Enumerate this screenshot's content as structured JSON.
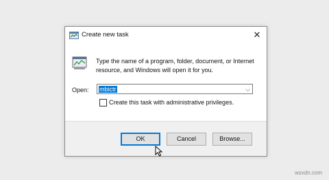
{
  "window": {
    "title": "Create new task",
    "close_glyph": "✕"
  },
  "dialog": {
    "description": "Type the name of a program, folder, document, or Internet resource, and Windows will open it for you.",
    "open_label": "Open:",
    "open_value": "mbictr",
    "dropdown_glyph": "⌵",
    "admin_checkbox_label": "Create this task with administrative privileges.",
    "admin_checkbox_checked": false
  },
  "buttons": {
    "ok": "OK",
    "cancel": "Cancel",
    "browse": "Browse..."
  },
  "icons": {
    "title": "task-manager-icon",
    "dialog": "run-task-icon",
    "close": "close-icon",
    "dropdown": "chevron-down-icon",
    "cursor": "mouse-pointer-icon"
  },
  "colors": {
    "accent": "#0078d7"
  },
  "watermark": "wsxdn.com"
}
